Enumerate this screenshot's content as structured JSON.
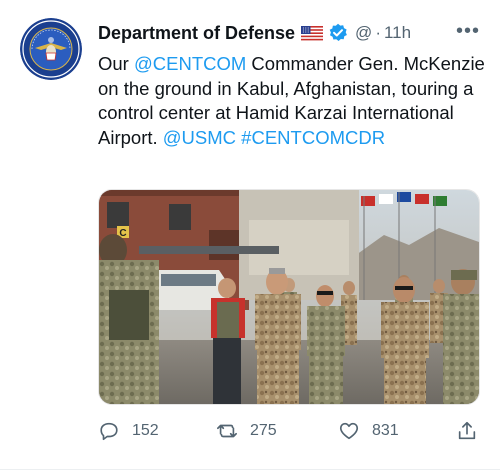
{
  "tweet": {
    "author_name": "Department of Defense",
    "handle": "@",
    "separator": "·",
    "time": "11h",
    "more_label": "•••",
    "avatar_icon": "dod-seal-logo",
    "badges": [
      "us-flag-icon",
      "verified-badge-icon"
    ],
    "text": [
      {
        "t": "Our ",
        "type": "text"
      },
      {
        "t": "@CENTCOM",
        "type": "link"
      },
      {
        "t": " Commander Gen. McKenzie on the ground in Kabul, Afghanistan, touring a control center at Hamid Karzai International Airport. ",
        "type": "text"
      },
      {
        "t": "@USMC",
        "type": "link"
      },
      {
        "t": " #CENTCOMCDR",
        "type": "link"
      }
    ],
    "media": {
      "type": "photo",
      "sign_letter": "C"
    },
    "actions": {
      "reply_count": "152",
      "retweet_count": "275",
      "like_count": "831"
    }
  },
  "colors": {
    "link": "#1d9bf0",
    "secondary_text": "#536471",
    "verified": "#1d9bf0"
  }
}
